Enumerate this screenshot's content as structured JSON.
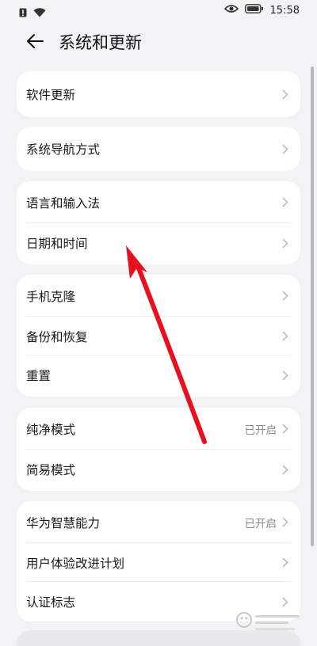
{
  "status_bar": {
    "time": "15:58",
    "left_icons": [
      "sim-alert-icon",
      "wifi-icon"
    ],
    "right_icons": [
      "eye-icon",
      "battery-icon"
    ]
  },
  "header": {
    "back_icon": "back-arrow-icon",
    "title": "系统和更新"
  },
  "groups": [
    {
      "items": [
        {
          "label": "软件更新",
          "value": ""
        }
      ]
    },
    {
      "items": [
        {
          "label": "系统导航方式",
          "value": ""
        }
      ]
    },
    {
      "items": [
        {
          "label": "语言和输入法",
          "value": ""
        },
        {
          "label": "日期和时间",
          "value": ""
        }
      ]
    },
    {
      "items": [
        {
          "label": "手机克隆",
          "value": ""
        },
        {
          "label": "备份和恢复",
          "value": ""
        },
        {
          "label": "重置",
          "value": ""
        }
      ]
    },
    {
      "items": [
        {
          "label": "纯净模式",
          "value": "已开启"
        },
        {
          "label": "简易模式",
          "value": ""
        }
      ]
    },
    {
      "items": [
        {
          "label": "华为智慧能力",
          "value": "已开启"
        },
        {
          "label": "用户体验改进计划",
          "value": ""
        },
        {
          "label": "认证标志",
          "value": ""
        }
      ]
    }
  ],
  "annotation": {
    "color": "#e8101f",
    "points_to": "日期和时间"
  },
  "colors": {
    "background": "#f1f3f5",
    "card": "#ffffff",
    "chevron": "#b5b5b5",
    "secondary_text": "#8a8a8a"
  }
}
